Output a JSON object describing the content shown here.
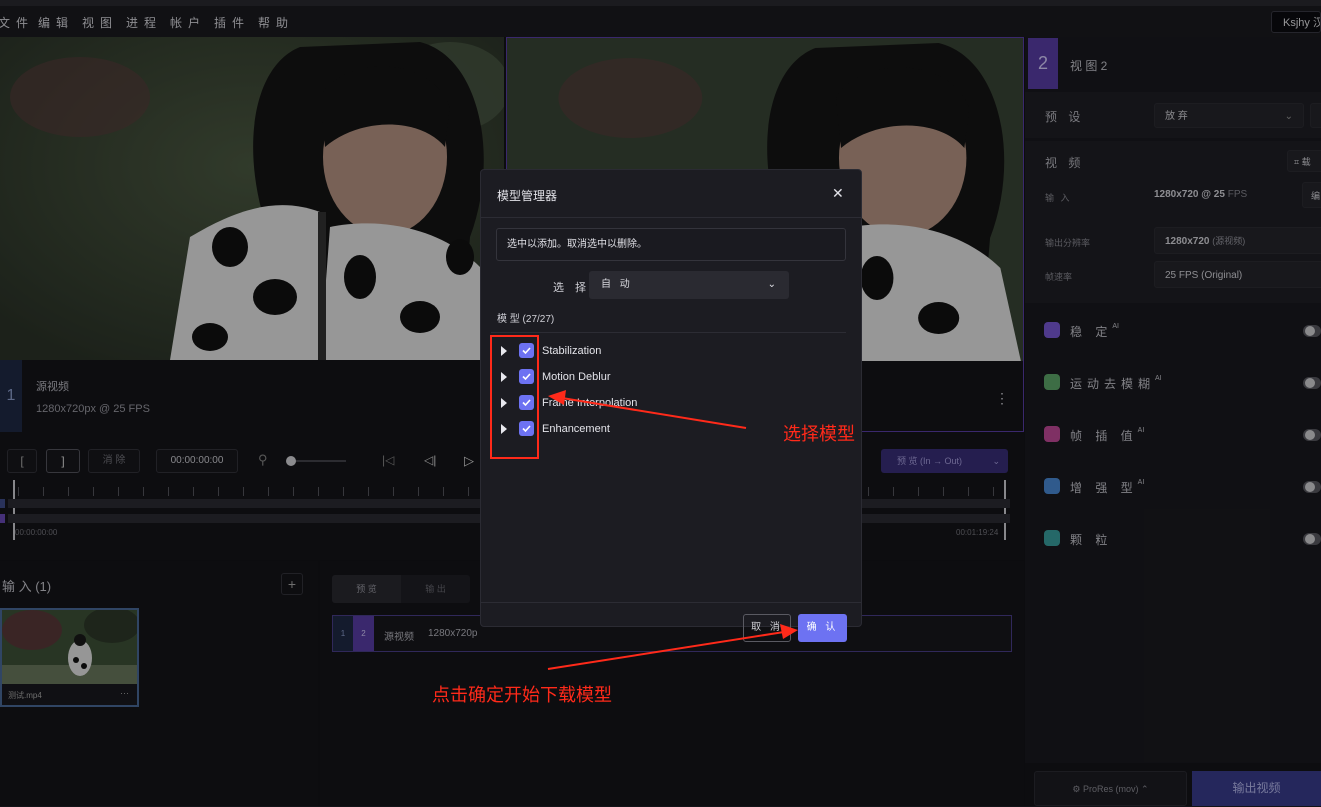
{
  "menu": [
    "文件",
    "编辑",
    "视图",
    "进程",
    "帐户",
    "插件",
    "帮助"
  ],
  "user_button": "Ksjhy 汉",
  "source": {
    "number": "1",
    "title": "源视频",
    "spec": "1280x720px @ 25 FPS"
  },
  "preview_view": {
    "number": "2",
    "title": "视 图 2"
  },
  "timeline": {
    "in_bracket": "[",
    "out_bracket": "]",
    "clear": "消 除",
    "timecode": "00:00:00:00",
    "start_time": "00:00:00:00",
    "end_time": "00:01:19:24",
    "preview_range": "预 览 (In → Out)"
  },
  "right_panel": {
    "preset_label": "预 设",
    "preset_value": "放 弃",
    "video_label": "视 频",
    "crop_label": "载",
    "input_label": "输 入",
    "input_value_res": "1280x720",
    "input_value_fps": "@ 25",
    "input_value_unit": "FPS",
    "input_edit": "编",
    "output_res_label": "输出分辨率",
    "output_res_value": "1280x720",
    "output_res_note": "(源视频)",
    "fps_label": "帧速率",
    "fps_value": "25 FPS (Original)",
    "features": [
      {
        "label": "稳 定",
        "sup": "AI",
        "color": "#7a5ad8"
      },
      {
        "label": "运动去模糊",
        "sup": "AI",
        "color": "#5fa86a"
      },
      {
        "label": "帧 插 值",
        "sup": "AI",
        "color": "#c44a9a"
      },
      {
        "label": "增 强 型",
        "sup": "AI",
        "color": "#4a8ad8"
      },
      {
        "label": "颗 粒",
        "sup": "",
        "color": "#3aa0a0"
      }
    ],
    "export_format": "ProRes (mov)",
    "export_button": "输出视频"
  },
  "inputs": {
    "title": "输 入 (1)",
    "add": "+",
    "file": "测试.mp4",
    "more": "···"
  },
  "output_tabs": {
    "preview": "预 览",
    "output": "输 出"
  },
  "queue_row": {
    "n1": "1",
    "n2": "2",
    "title": "源视频",
    "spec": "1280x720p"
  },
  "modal": {
    "title": "模型管理器",
    "close": "✕",
    "hint": "选中以添加。取消选中以删除。",
    "select_label": "选 择",
    "select_value": "自 动",
    "models_header": "模 型 (27/27)",
    "models": [
      "Stabilization",
      "Motion Deblur",
      "Frame Interpolation",
      "Enhancement"
    ],
    "cancel": "取 消",
    "confirm": "确 认"
  },
  "annotations": {
    "select_model": "选择模型",
    "click_confirm": "点击确定开始下载模型"
  },
  "colors": {
    "accent": "#6d72f2",
    "annotation": "#ff2a1a",
    "view2": "#5a3ea8",
    "view1": "#1f2a45"
  }
}
